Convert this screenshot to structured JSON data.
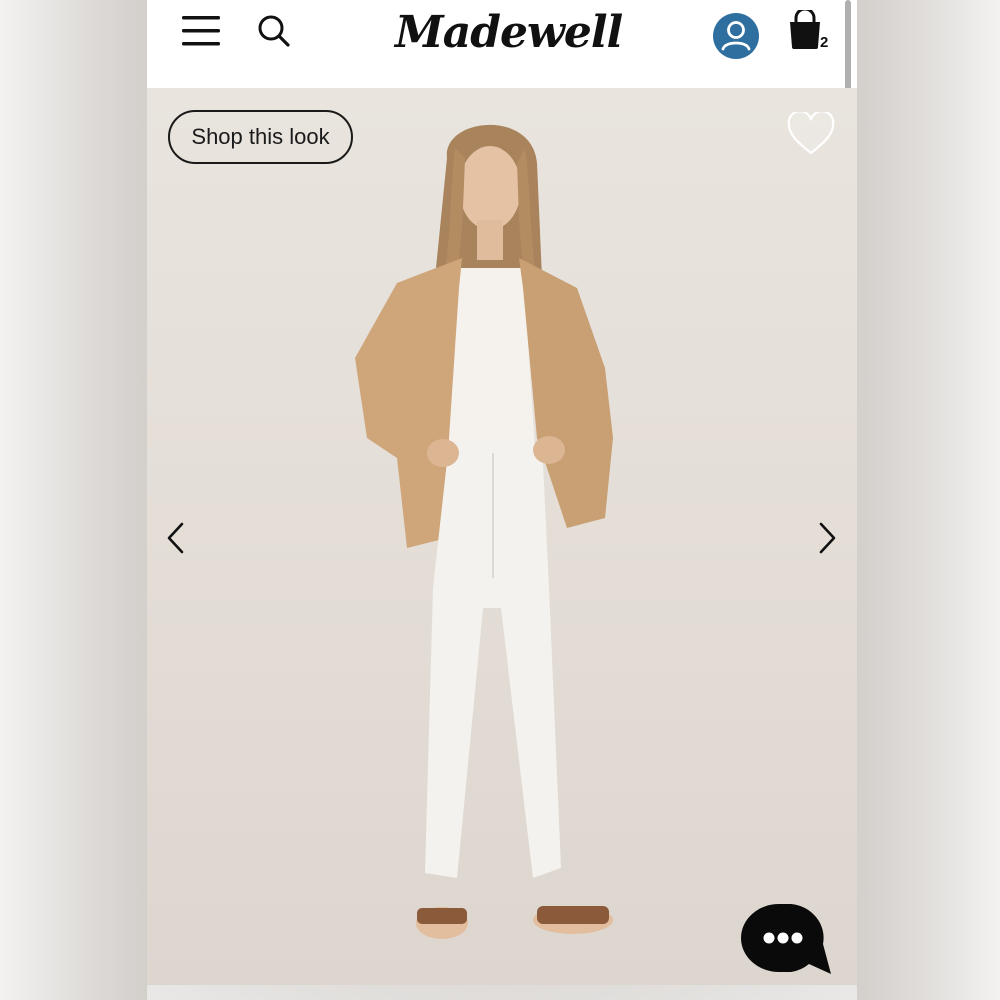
{
  "brand": {
    "logo_text": "Madewell"
  },
  "header": {
    "menu_icon": "hamburger-menu-icon",
    "search_icon": "search-icon",
    "account_icon": "account-icon",
    "bag_icon": "shopping-bag-icon",
    "bag_count": "2",
    "account_color": "#2f6fa0"
  },
  "hero": {
    "shop_this_look_label": "Shop this look",
    "favorite_icon": "heart-outline-icon",
    "prev_icon": "chevron-left-icon",
    "next_icon": "chevron-right-icon",
    "image_subject": "model-photo"
  },
  "chat": {
    "icon": "chat-bubble-icon"
  }
}
